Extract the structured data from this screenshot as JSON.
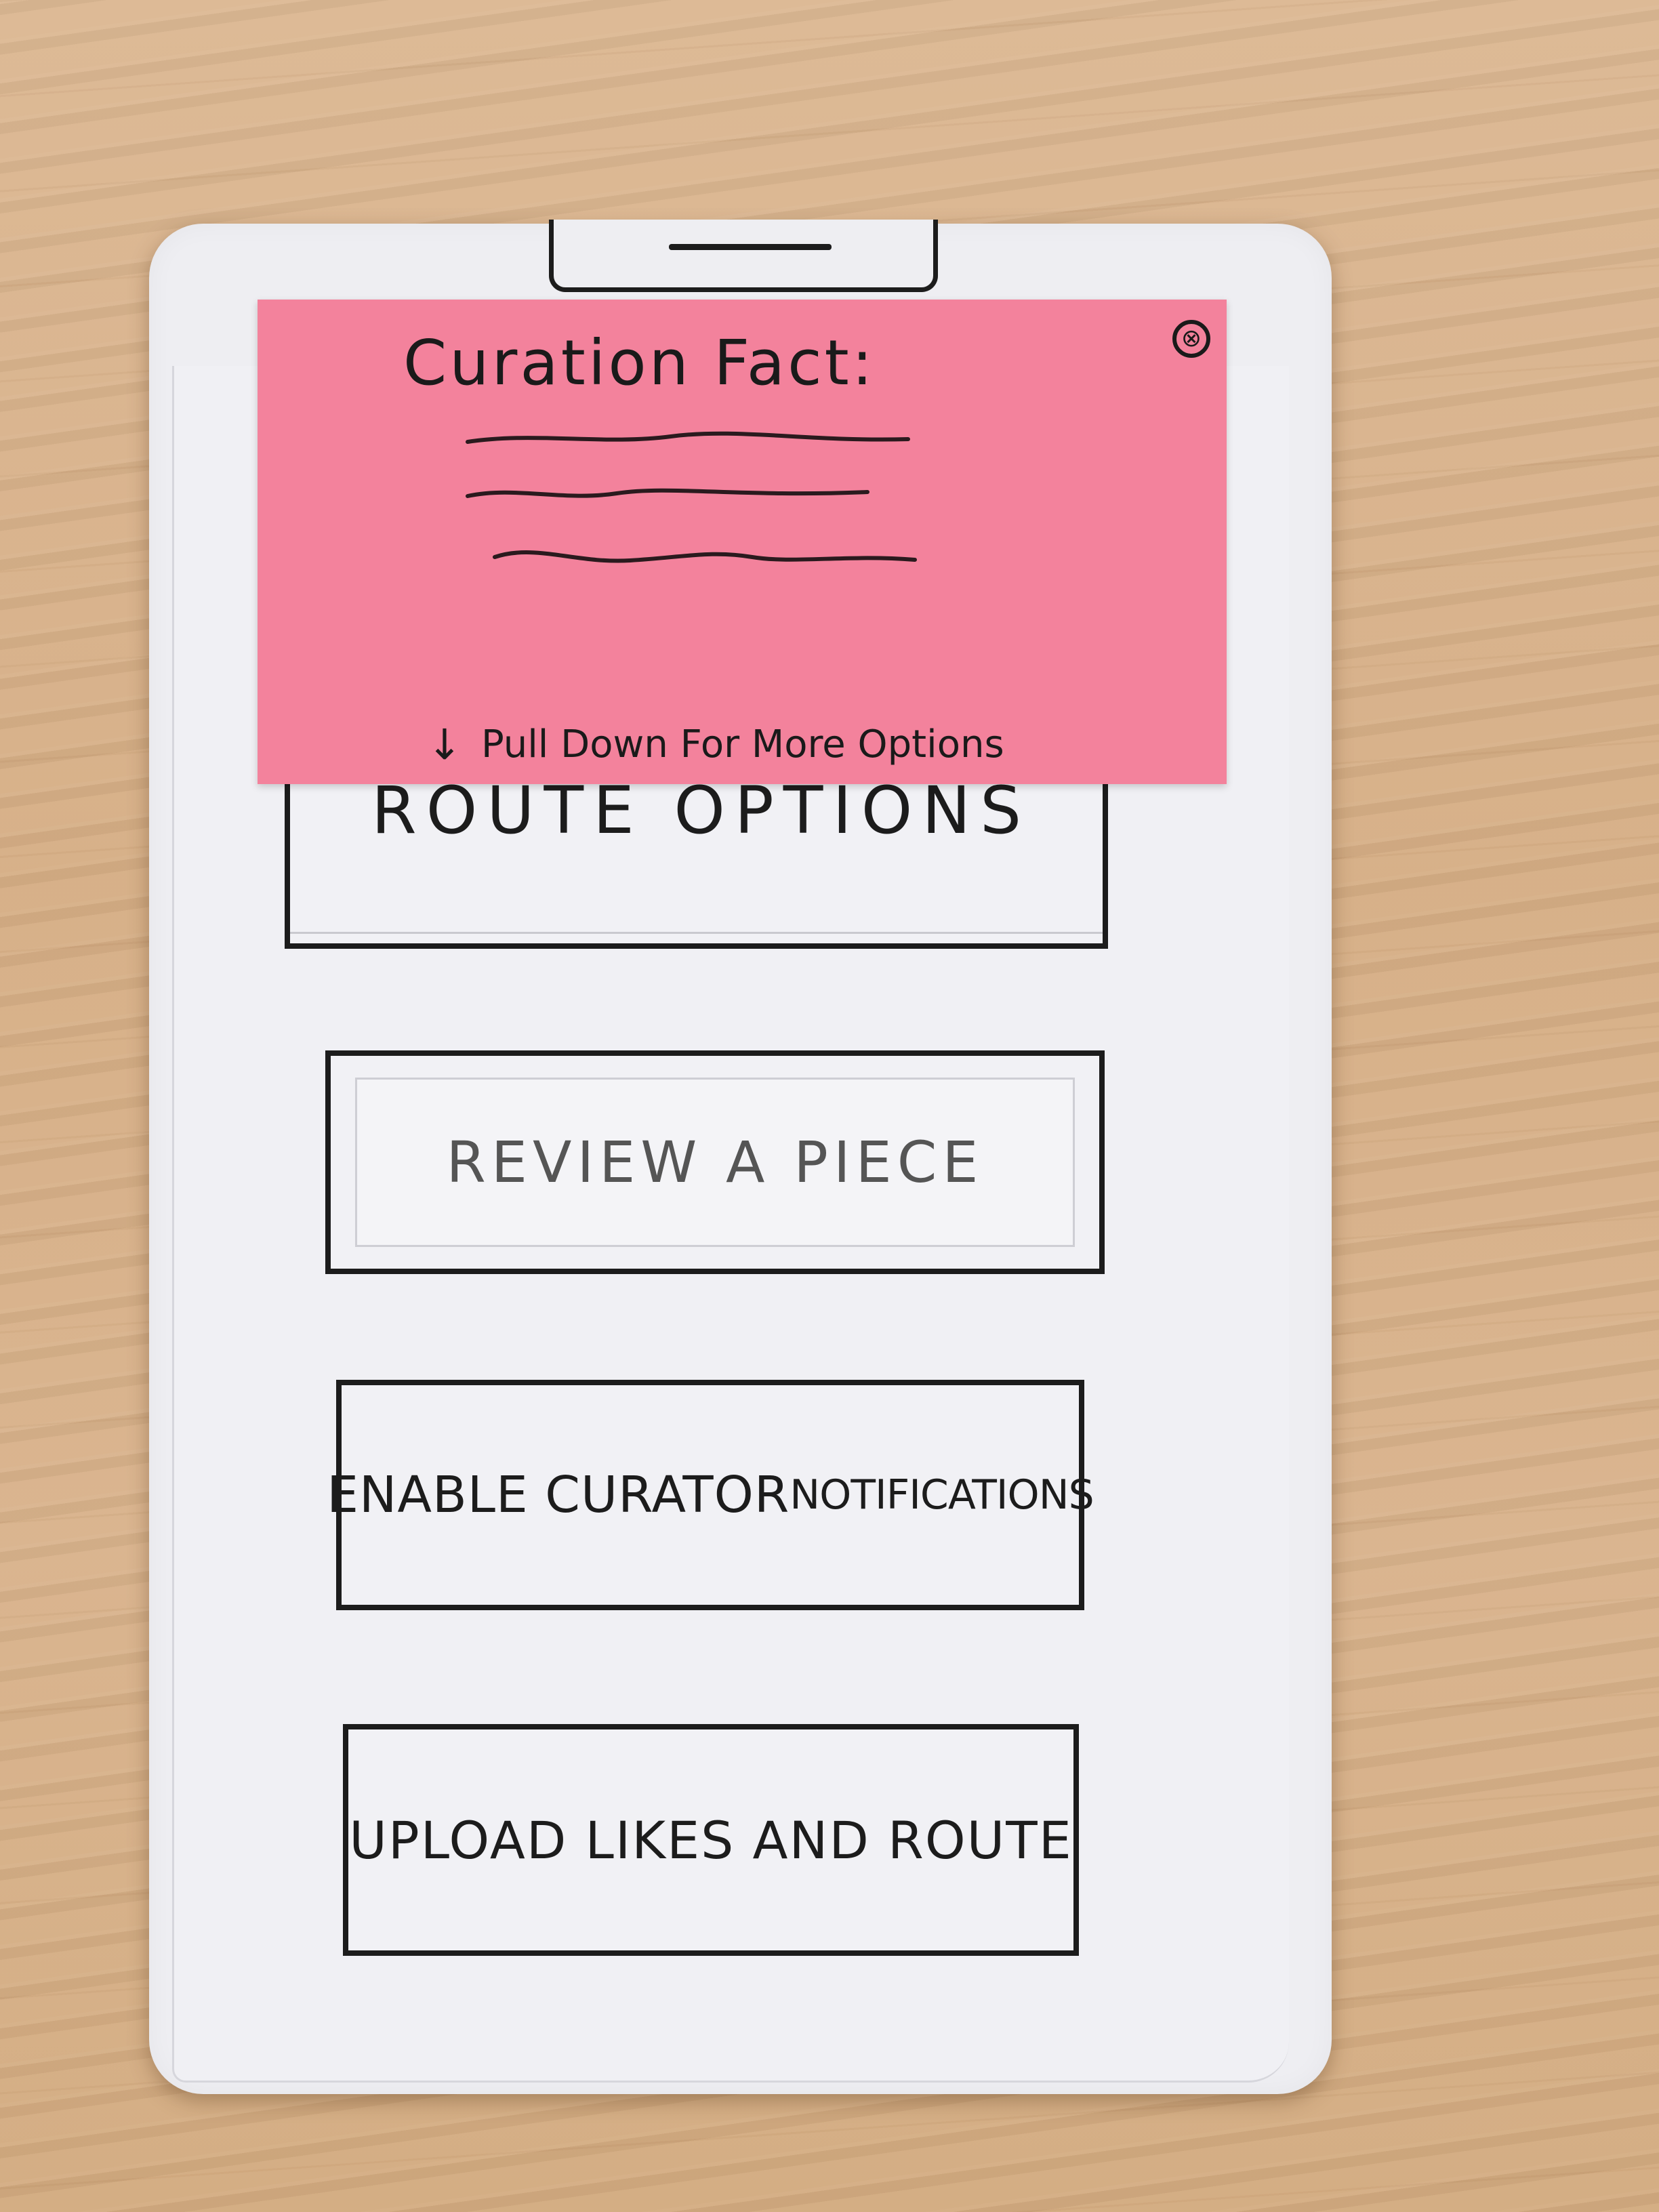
{
  "sticky_note": {
    "title": "Curation Fact:",
    "close_symbol": "⊗",
    "pull_arrow": "↓",
    "pull_hint": "Pull Down For More Options"
  },
  "menu": {
    "route_options": "ROUTE OPTIONS",
    "review_piece": "REVIEW A PIECE",
    "enable_notifications_main": "ENABLE CURATOR ",
    "enable_notifications_small": "NOTIFICATIONS",
    "upload_likes": "UPLOAD LIKES AND ROUTE"
  },
  "colors": {
    "sticky_note": "#f3829c",
    "paper": "#eeeef2",
    "ink": "#1c1c1c",
    "table_wood": "#d9b48c"
  },
  "icons": {
    "close": "close-icon",
    "arrow": "arrow-down-icon"
  }
}
